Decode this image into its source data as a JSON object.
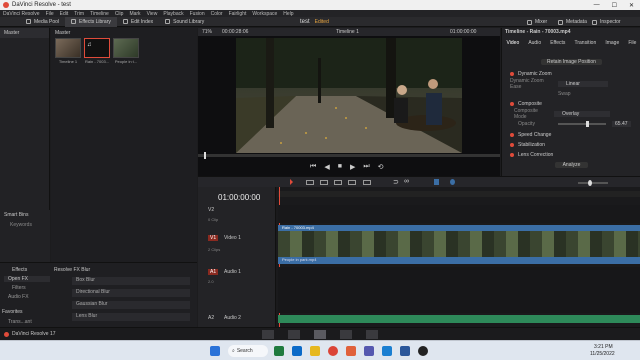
{
  "window": {
    "title": "DaVinci Resolve - test",
    "controls": [
      "—",
      "☐",
      "✕"
    ]
  },
  "menu": [
    "DaVinci Resolve",
    "File",
    "Edit",
    "Trim",
    "Timeline",
    "Clip",
    "Mark",
    "View",
    "Playback",
    "Fusion",
    "Color",
    "Fairlight",
    "Workspace",
    "Help"
  ],
  "toolbar": {
    "media_pool": "Media Pool",
    "effects_library": "Effects Library",
    "edit_index": "Edit Index",
    "sound_library": "Sound Library",
    "project_name": "test",
    "project_status": "Edited",
    "mixer": "Mixer",
    "metadata": "Metadata",
    "inspector": "Inspector"
  },
  "media": {
    "sidebar_title": "Master",
    "pool_title": "Master",
    "clips": [
      {
        "name": "Timeline 1"
      },
      {
        "name": "Rain - 7003..."
      },
      {
        "name": "People in t..."
      }
    ],
    "smart_bins": "Smart Bins",
    "keywords": "Keywords"
  },
  "viewer": {
    "zoom": "71%",
    "timecode_left": "00:00:28:06",
    "timeline_name": "Timeline 1",
    "timecode_right": "01:00:00:00"
  },
  "inspector": {
    "title": "Timeline - Rain - 70003.mp4",
    "tabs": [
      "Video",
      "Audio",
      "Effects",
      "Transition",
      "Image",
      "File"
    ],
    "retain_image_position": "Retain Image Position",
    "dynamic_zoom": "Dynamic Zoom",
    "dynamic_zoom_ease_label": "Dynamic Zoom Ease",
    "dynamic_zoom_ease_value": "Linear",
    "swap": "Swap",
    "composite": "Composite",
    "composite_mode_label": "Composite Mode",
    "composite_mode_value": "Overlay",
    "opacity_label": "Opacity",
    "opacity_value": "65.47",
    "speed_change": "Speed Change",
    "stabilization": "Stabilization",
    "lens_correction": "Lens Correction",
    "analyze": "Analyze"
  },
  "timeline": {
    "timecode": "01:00:00:00",
    "tracks": [
      {
        "id": "V2",
        "name": "Video 2",
        "clips": "0 Clip"
      },
      {
        "id": "V1",
        "name": "Video 1",
        "clips": "2 Clips"
      },
      {
        "id": "A1",
        "name": "Audio 1",
        "clips": "2.0"
      },
      {
        "id": "A2",
        "name": "Audio 2",
        "clips": "2.0"
      }
    ],
    "clip_rain": "Rain - 70003.mp4",
    "clip_people": "People in park.mp4"
  },
  "effects": {
    "title": "Effects",
    "tree": [
      "Open FX",
      "Filters",
      "Audio FX"
    ],
    "fx_group": "Resolve FX Blur",
    "items": [
      "Box Blur",
      "Directional Blur",
      "Gaussian Blur",
      "Lens Blur"
    ],
    "favorites": "Favorites",
    "favorite_item": "Trans...ant"
  },
  "bottom": {
    "app_label": "DaVinci Resolve 17"
  },
  "taskbar": {
    "search": "Search",
    "time": "3:21 PM",
    "date": "11/25/2022"
  },
  "colors": {
    "accent_red": "#e04b3a",
    "clip_blue": "#3b6ea5",
    "audio_green": "#2e8a5a",
    "playhead": "#e04b3a"
  }
}
